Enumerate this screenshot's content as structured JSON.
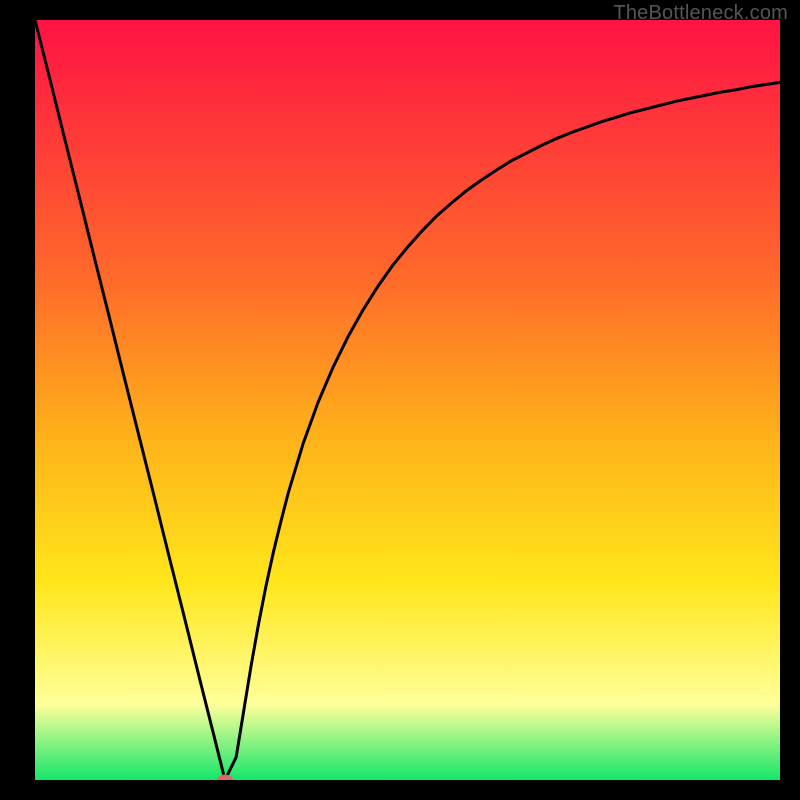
{
  "watermark": "TheBottleneck.com",
  "colors": {
    "gradient_top": "#ff1244",
    "gradient_upper_mid": "#ff6a2a",
    "gradient_mid": "#ffb21a",
    "gradient_lower_mid": "#ffe61a",
    "gradient_pale": "#ffff9a",
    "gradient_bottom": "#14e66a",
    "curve": "#000000",
    "marker": "#d66a6a",
    "background": "#000000"
  },
  "chart_data": {
    "type": "line",
    "title": "",
    "xlabel": "",
    "ylabel": "",
    "xlim": [
      0,
      100
    ],
    "ylim": [
      0,
      100
    ],
    "grid": false,
    "x": [
      0,
      2,
      4,
      6,
      8,
      10,
      12,
      14,
      16,
      18,
      20,
      22,
      24,
      25.5,
      27,
      28,
      29,
      30,
      31,
      32,
      33,
      34,
      36,
      38,
      40,
      42,
      44,
      46,
      48,
      50,
      52,
      54,
      56,
      58,
      60,
      62,
      64,
      66,
      68,
      70,
      72,
      74,
      76,
      78,
      80,
      82,
      84,
      86,
      88,
      90,
      92,
      94,
      96,
      98,
      100
    ],
    "values": [
      100,
      92.2,
      84.3,
      76.5,
      68.6,
      60.8,
      52.9,
      45.1,
      37.3,
      29.4,
      21.6,
      13.7,
      5.9,
      0,
      3,
      9,
      15,
      20.5,
      25.5,
      30,
      34,
      37.8,
      44.3,
      49.7,
      54.3,
      58.3,
      61.8,
      64.9,
      67.7,
      70.1,
      72.3,
      74.3,
      76,
      77.6,
      79,
      80.3,
      81.5,
      82.5,
      83.5,
      84.4,
      85.2,
      85.9,
      86.6,
      87.2,
      87.8,
      88.3,
      88.8,
      89.3,
      89.7,
      90.1,
      90.5,
      90.8,
      91.2,
      91.5,
      91.8
    ],
    "marker": {
      "x": 25.5,
      "y": 0
    },
    "legend": []
  }
}
